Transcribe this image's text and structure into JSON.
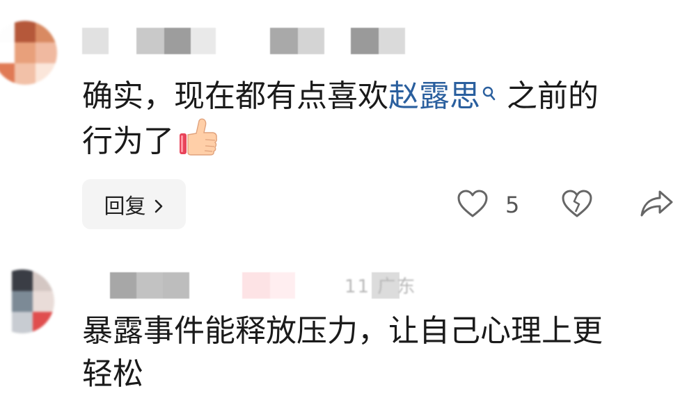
{
  "comments": [
    {
      "text_before": "确实，现在都有点喜欢",
      "link_text": "赵露思",
      "text_after": "之前的\n行为了",
      "reply_label": "回复",
      "like_count": "5",
      "avatar_icon": "avatar",
      "emoji_icon": "thumbs-up-icon"
    },
    {
      "meta_faint": "11 广东",
      "text": "暴露事件能释放压力，让自己心理上更\n轻松",
      "avatar_icon": "avatar"
    }
  ],
  "colors": {
    "link": "#2a5f9e",
    "text": "#1a1a1a",
    "reply_bg": "#f4f4f4",
    "icon": "#666666"
  }
}
